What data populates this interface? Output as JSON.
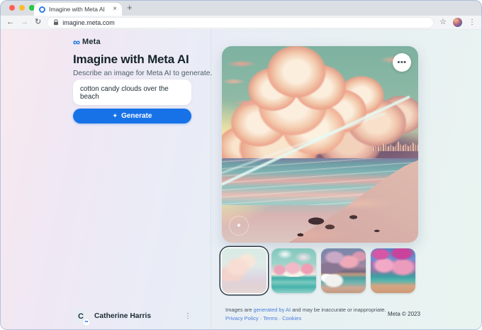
{
  "browser": {
    "tab_title": "Imagine with Meta AI",
    "url": "imagine.meta.com",
    "icons": {
      "close_tab": "×",
      "new_tab": "+",
      "back": "←",
      "forward": "→",
      "reload": "↻",
      "bookmark": "☆",
      "menu": "⋮"
    }
  },
  "panel": {
    "brand": "Meta",
    "brand_mark": "∞",
    "title": "Imagine with Meta AI",
    "subtitle": "Describe an image for Meta AI to generate.",
    "prompt": {
      "value": "cotton candy clouds over the beach"
    },
    "generate": {
      "icon": "✦",
      "label": "Generate"
    },
    "user": {
      "name": "Catherine Harris",
      "initial": "C",
      "badge_mark": "∞",
      "menu_icon": "⋮"
    }
  },
  "viewer": {
    "options_icon": "•••",
    "watermark_icon": "✦",
    "thumbnails": [
      {
        "selected": true
      },
      {
        "selected": false
      },
      {
        "selected": false
      },
      {
        "selected": false
      }
    ]
  },
  "footer": {
    "disclaimer_prefix": "Images are",
    "disclaimer_link": "generated by AI",
    "disclaimer_suffix": "and may be inaccurate or inappropriate.",
    "link_privacy": "Privacy Policy",
    "link_terms": "Terms",
    "link_cookies": "Cookies",
    "separator": "·",
    "copyright": "Meta © 2023"
  },
  "colors": {
    "accent_blue": "#1772e8",
    "link_blue": "#4a7ddc",
    "text_dark": "#1c2b33",
    "text_muted": "#4f6069"
  }
}
